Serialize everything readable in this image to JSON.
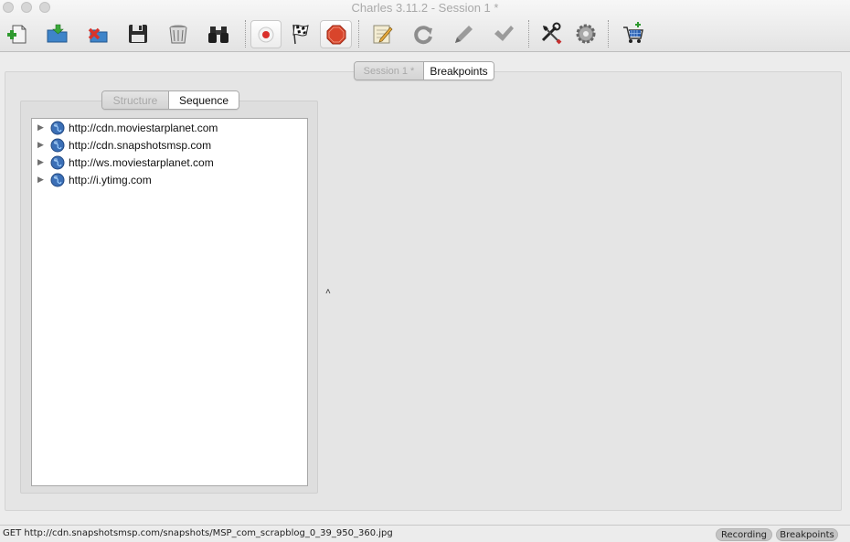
{
  "window": {
    "title": "Charles 3.11.2 - Session 1 *"
  },
  "toolbar": {
    "buttons": [
      {
        "name": "new-session",
        "icon": "new-document-plus-icon"
      },
      {
        "name": "open-session",
        "icon": "open-folder-icon"
      },
      {
        "name": "close-session",
        "icon": "close-document-icon"
      },
      {
        "name": "save-session",
        "icon": "floppy-disk-icon"
      },
      {
        "name": "clear-session",
        "icon": "trash-bin-icon"
      },
      {
        "name": "find",
        "icon": "binoculars-icon"
      },
      {
        "name": "record",
        "icon": "record-icon"
      },
      {
        "name": "throttle",
        "icon": "checkered-flag-icon"
      },
      {
        "name": "breakpoints",
        "icon": "stop-sign-icon"
      },
      {
        "name": "compose",
        "icon": "pencil-notepad-icon"
      },
      {
        "name": "repeat",
        "icon": "refresh-icon"
      },
      {
        "name": "edit",
        "icon": "pencil-icon"
      },
      {
        "name": "validate",
        "icon": "checkmark-icon"
      },
      {
        "name": "tools",
        "icon": "wrench-screwdriver-icon"
      },
      {
        "name": "settings",
        "icon": "gear-icon"
      },
      {
        "name": "buy",
        "icon": "shopping-cart-icon"
      }
    ]
  },
  "session_tabs": {
    "session": "Session 1 *",
    "breakpoints": "Breakpoints"
  },
  "view_tabs": {
    "structure": "Structure",
    "sequence": "Sequence"
  },
  "hosts": [
    "http://cdn.moviestarplanet.com",
    "http://cdn.snapshotsmsp.com",
    "http://ws.moviestarplanet.com",
    "http://i.ytimg.com"
  ],
  "status": {
    "message": "GET http://cdn.snapshotsmsp.com/snapshots/MSP_com_scrapblog_0_39_950_360.jpg",
    "recording": "Recording",
    "breakpoints": "Breakpoints"
  },
  "colors": {
    "stop_sign": "#d9452b",
    "record_dot": "#d9302b",
    "globe": "#3b6fb6",
    "cart": "#2a5fb0"
  }
}
